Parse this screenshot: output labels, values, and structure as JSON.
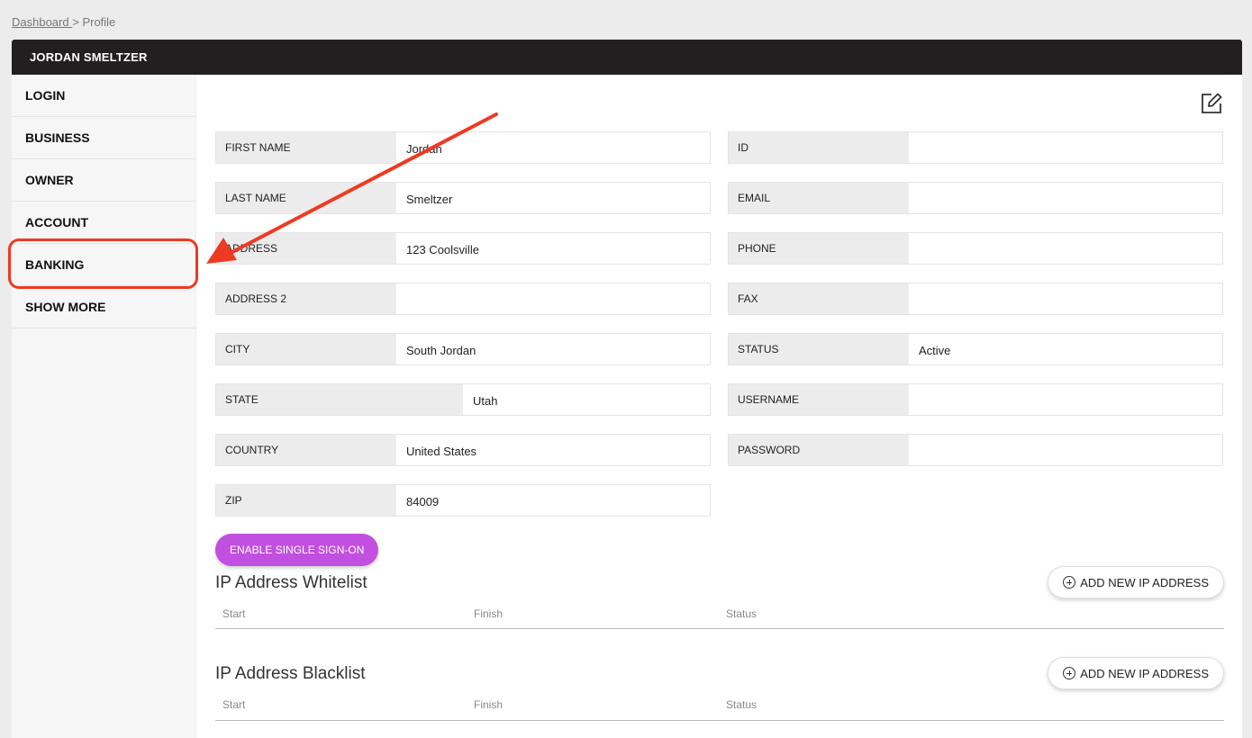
{
  "breadcrumb": {
    "link": "Dashboard ",
    "separator": ">",
    "current": "Profile"
  },
  "header": {
    "title": "JORDAN SMELTZER"
  },
  "sidebar": {
    "items": [
      {
        "label": "LOGIN"
      },
      {
        "label": "BUSINESS"
      },
      {
        "label": "OWNER"
      },
      {
        "label": "ACCOUNT"
      },
      {
        "label": "BANKING"
      },
      {
        "label": "SHOW MORE"
      }
    ]
  },
  "fields": {
    "first_name": {
      "label": "FIRST NAME",
      "value": "Jordan"
    },
    "last_name": {
      "label": "LAST NAME",
      "value": "Smeltzer"
    },
    "address": {
      "label": "ADDRESS",
      "value": "123 Coolsville"
    },
    "address2": {
      "label": "ADDRESS 2",
      "value": ""
    },
    "city": {
      "label": "CITY",
      "value": "South Jordan"
    },
    "state": {
      "label": "STATE",
      "value": "Utah"
    },
    "country": {
      "label": "COUNTRY",
      "value": "United States"
    },
    "zip": {
      "label": "ZIP",
      "value": "84009"
    },
    "id": {
      "label": "ID",
      "value": ""
    },
    "email": {
      "label": "EMAIL",
      "value": ""
    },
    "phone": {
      "label": "PHONE",
      "value": ""
    },
    "fax": {
      "label": "FAX",
      "value": ""
    },
    "status": {
      "label": "STATUS",
      "value": "Active"
    },
    "username": {
      "label": "USERNAME",
      "value": ""
    },
    "password": {
      "label": "PASSWORD",
      "value": ""
    }
  },
  "sso_button": {
    "label": "ENABLE SINGLE SIGN-ON"
  },
  "whitelist": {
    "title": "IP Address Whitelist",
    "add_label": "ADD NEW IP ADDRESS",
    "columns": [
      "Start",
      "Finish",
      "Status"
    ]
  },
  "blacklist": {
    "title": "IP Address Blacklist",
    "add_label": "ADD NEW IP ADDRESS",
    "columns": [
      "Start",
      "Finish",
      "Status"
    ]
  },
  "colors": {
    "header_bg": "#231f20",
    "sso_button": "#c14fe0",
    "annotation": "#ee3a23"
  },
  "icons": {
    "edit": "edit-icon",
    "add": "plus-circle-icon",
    "annotation_arrow": "arrow-icon"
  }
}
